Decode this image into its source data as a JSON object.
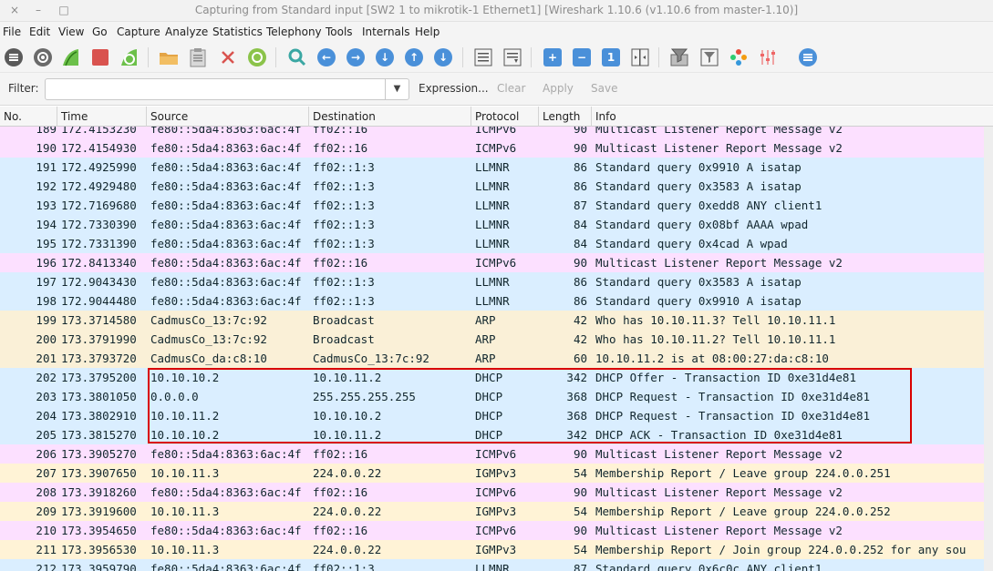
{
  "window": {
    "title": "Capturing from Standard input   [SW2 1 to mikrotik-1 Ethernet1]   [Wireshark 1.10.6  (v1.10.6 from master-1.10)]",
    "controls": [
      "×",
      "–",
      "□"
    ]
  },
  "menu": [
    "File",
    "Edit",
    "View",
    "Go",
    "Capture",
    "Analyze",
    "Statistics",
    "Telephony",
    "Tools",
    "Internals",
    "Help"
  ],
  "toolbar": {
    "icons": [
      "interfaces-icon",
      "capture-options-icon",
      "start-capture-icon",
      "stop-capture-icon",
      "restart-capture-icon",
      "open-file-icon",
      "save-file-icon",
      "close-file-icon",
      "reload-icon",
      "find-packet-icon",
      "go-back-icon",
      "go-forward-icon",
      "go-to-packet-icon",
      "go-first-icon",
      "go-last-icon",
      "colorize-icon",
      "auto-scroll-icon",
      "zoom-in-icon",
      "zoom-out-icon",
      "normal-size-icon",
      "resize-columns-icon",
      "capture-filters-icon",
      "display-filters-icon",
      "coloring-rules-icon",
      "preferences-icon",
      "help-icon"
    ]
  },
  "filter": {
    "label": "Filter:",
    "value": "",
    "expression_label": "Expression...",
    "clear_label": "Clear",
    "apply_label": "Apply",
    "save_label": "Save"
  },
  "columns": {
    "no": "No.",
    "time": "Time",
    "source": "Source",
    "destination": "Destination",
    "protocol": "Protocol",
    "length": "Length",
    "info": "Info"
  },
  "colors": {
    "icmpv6": "#fce0ff",
    "llmnr": "#daeeff",
    "arp": "#faf0d7",
    "dhcp": "#daeeff",
    "igmp": "#fff3d6",
    "highlight_border": "#d90000"
  },
  "rows": [
    {
      "no": "189",
      "time": "172.4153230",
      "src": "fe80::5da4:8363:6ac:4f",
      "dst": "ff02::16",
      "proto": "ICMPv6",
      "len": "90",
      "info": "Multicast Listener Report Message v2",
      "type": "icmpv6"
    },
    {
      "no": "190",
      "time": "172.4154930",
      "src": "fe80::5da4:8363:6ac:4f",
      "dst": "ff02::16",
      "proto": "ICMPv6",
      "len": "90",
      "info": "Multicast Listener Report Message v2",
      "type": "icmpv6"
    },
    {
      "no": "191",
      "time": "172.4925990",
      "src": "fe80::5da4:8363:6ac:4f",
      "dst": "ff02::1:3",
      "proto": "LLMNR",
      "len": "86",
      "info": "Standard query 0x9910  A isatap",
      "type": "llmnr"
    },
    {
      "no": "192",
      "time": "172.4929480",
      "src": "fe80::5da4:8363:6ac:4f",
      "dst": "ff02::1:3",
      "proto": "LLMNR",
      "len": "86",
      "info": "Standard query 0x3583  A isatap",
      "type": "llmnr"
    },
    {
      "no": "193",
      "time": "172.7169680",
      "src": "fe80::5da4:8363:6ac:4f",
      "dst": "ff02::1:3",
      "proto": "LLMNR",
      "len": "87",
      "info": "Standard query 0xedd8  ANY client1",
      "type": "llmnr"
    },
    {
      "no": "194",
      "time": "172.7330390",
      "src": "fe80::5da4:8363:6ac:4f",
      "dst": "ff02::1:3",
      "proto": "LLMNR",
      "len": "84",
      "info": "Standard query 0x08bf  AAAA wpad",
      "type": "llmnr"
    },
    {
      "no": "195",
      "time": "172.7331390",
      "src": "fe80::5da4:8363:6ac:4f",
      "dst": "ff02::1:3",
      "proto": "LLMNR",
      "len": "84",
      "info": "Standard query 0x4cad  A wpad",
      "type": "llmnr"
    },
    {
      "no": "196",
      "time": "172.8413340",
      "src": "fe80::5da4:8363:6ac:4f",
      "dst": "ff02::16",
      "proto": "ICMPv6",
      "len": "90",
      "info": "Multicast Listener Report Message v2",
      "type": "icmpv6"
    },
    {
      "no": "197",
      "time": "172.9043430",
      "src": "fe80::5da4:8363:6ac:4f",
      "dst": "ff02::1:3",
      "proto": "LLMNR",
      "len": "86",
      "info": "Standard query 0x3583  A isatap",
      "type": "llmnr"
    },
    {
      "no": "198",
      "time": "172.9044480",
      "src": "fe80::5da4:8363:6ac:4f",
      "dst": "ff02::1:3",
      "proto": "LLMNR",
      "len": "86",
      "info": "Standard query 0x9910  A isatap",
      "type": "llmnr"
    },
    {
      "no": "199",
      "time": "173.3714580",
      "src": "CadmusCo_13:7c:92",
      "dst": "Broadcast",
      "proto": "ARP",
      "len": "42",
      "info": "Who has 10.10.11.3?  Tell 10.10.11.1",
      "type": "arp"
    },
    {
      "no": "200",
      "time": "173.3791990",
      "src": "CadmusCo_13:7c:92",
      "dst": "Broadcast",
      "proto": "ARP",
      "len": "42",
      "info": "Who has 10.10.11.2?  Tell 10.10.11.1",
      "type": "arp"
    },
    {
      "no": "201",
      "time": "173.3793720",
      "src": "CadmusCo_da:c8:10",
      "dst": "CadmusCo_13:7c:92",
      "proto": "ARP",
      "len": "60",
      "info": "10.10.11.2 is at 08:00:27:da:c8:10",
      "type": "arp"
    },
    {
      "no": "202",
      "time": "173.3795200",
      "src": "10.10.10.2",
      "dst": "10.10.11.2",
      "proto": "DHCP",
      "len": "342",
      "info": "DHCP Offer    - Transaction ID 0xe31d4e81",
      "type": "dhcp"
    },
    {
      "no": "203",
      "time": "173.3801050",
      "src": "0.0.0.0",
      "dst": "255.255.255.255",
      "proto": "DHCP",
      "len": "368",
      "info": "DHCP Request  - Transaction ID 0xe31d4e81",
      "type": "dhcp"
    },
    {
      "no": "204",
      "time": "173.3802910",
      "src": "10.10.11.2",
      "dst": "10.10.10.2",
      "proto": "DHCP",
      "len": "368",
      "info": "DHCP Request  - Transaction ID 0xe31d4e81",
      "type": "dhcp"
    },
    {
      "no": "205",
      "time": "173.3815270",
      "src": "10.10.10.2",
      "dst": "10.10.11.2",
      "proto": "DHCP",
      "len": "342",
      "info": "DHCP ACK      - Transaction ID 0xe31d4e81",
      "type": "dhcp"
    },
    {
      "no": "206",
      "time": "173.3905270",
      "src": "fe80::5da4:8363:6ac:4f",
      "dst": "ff02::16",
      "proto": "ICMPv6",
      "len": "90",
      "info": "Multicast Listener Report Message v2",
      "type": "icmpv6"
    },
    {
      "no": "207",
      "time": "173.3907650",
      "src": "10.10.11.3",
      "dst": "224.0.0.22",
      "proto": "IGMPv3",
      "len": "54",
      "info": "Membership Report / Leave group 224.0.0.251",
      "type": "igmp"
    },
    {
      "no": "208",
      "time": "173.3918260",
      "src": "fe80::5da4:8363:6ac:4f",
      "dst": "ff02::16",
      "proto": "ICMPv6",
      "len": "90",
      "info": "Multicast Listener Report Message v2",
      "type": "icmpv6"
    },
    {
      "no": "209",
      "time": "173.3919600",
      "src": "10.10.11.3",
      "dst": "224.0.0.22",
      "proto": "IGMPv3",
      "len": "54",
      "info": "Membership Report / Leave group 224.0.0.252",
      "type": "igmp"
    },
    {
      "no": "210",
      "time": "173.3954650",
      "src": "fe80::5da4:8363:6ac:4f",
      "dst": "ff02::16",
      "proto": "ICMPv6",
      "len": "90",
      "info": "Multicast Listener Report Message v2",
      "type": "icmpv6"
    },
    {
      "no": "211",
      "time": "173.3956530",
      "src": "10.10.11.3",
      "dst": "224.0.0.22",
      "proto": "IGMPv3",
      "len": "54",
      "info": "Membership Report / Join group 224.0.0.252 for any sou",
      "type": "igmp"
    },
    {
      "no": "212",
      "time": "173.3959790",
      "src": "fe80::5da4:8363:6ac:4f",
      "dst": "ff02::1:3",
      "proto": "LLMNR",
      "len": "87",
      "info": "Standard query 0x6c0c  ANY client1",
      "type": "llmnr"
    }
  ]
}
